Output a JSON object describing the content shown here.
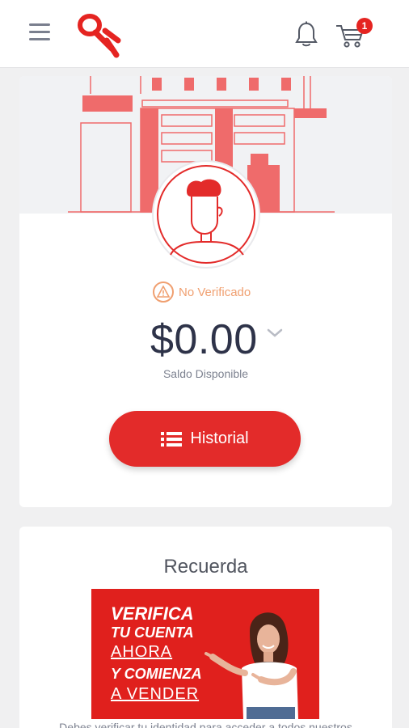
{
  "header": {
    "menu_icon": "hamburger-menu-icon",
    "logo_text": "OK",
    "bell_icon": "bell-icon",
    "cart_icon": "shopping-cart-icon",
    "cart_count": "1"
  },
  "wallet": {
    "status": "No Verificado",
    "status_icon": "warning-icon",
    "balance": "$0.00",
    "balance_label": "Saldo Disponible",
    "history_button": "Historial",
    "history_icon": "list-icon"
  },
  "reminder": {
    "title": "Recuerda",
    "banner": {
      "line1": "VERIFICA",
      "line2": "TU CUENTA",
      "line3": "AHORA",
      "line4": "Y COMIENZA",
      "line5": "A VENDER"
    },
    "description": "Debes verificar tu identidad para acceder a todos nuestros"
  },
  "colors": {
    "brand_red": "#e32b2a",
    "warning_orange": "#f0a071",
    "text_dark": "#2e3349",
    "text_muted": "#7d8290"
  }
}
